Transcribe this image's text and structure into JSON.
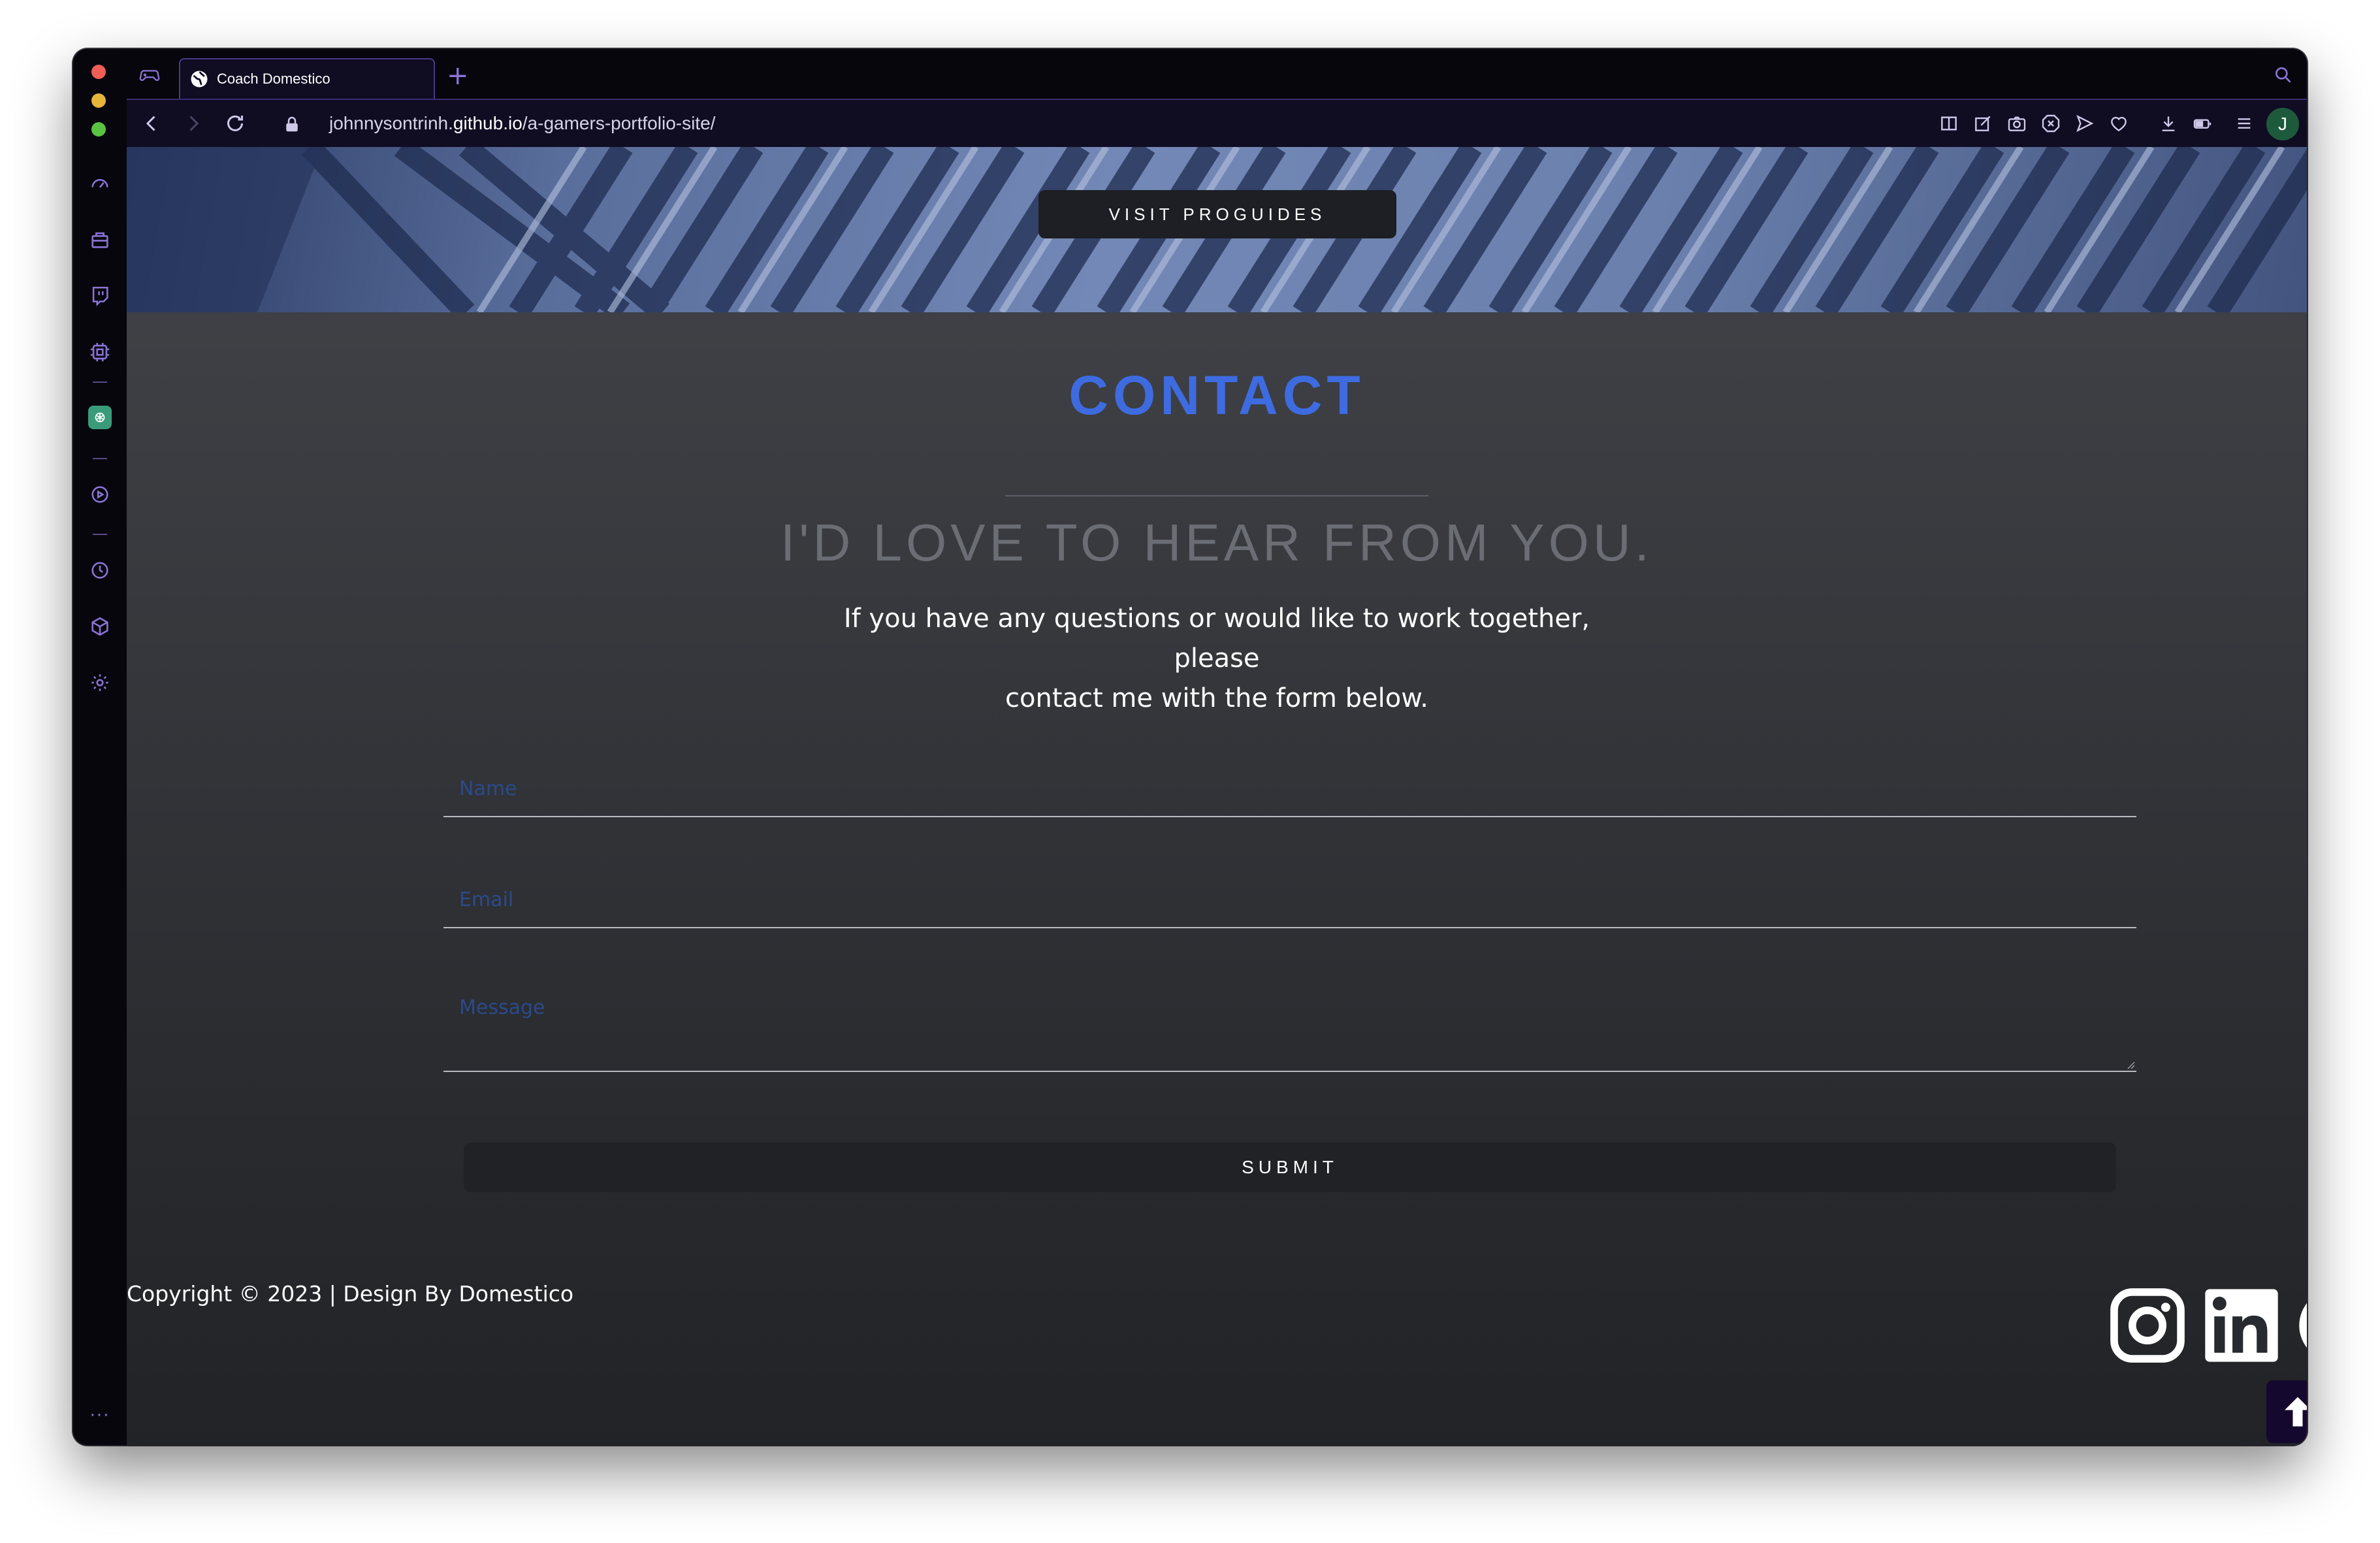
{
  "browser": {
    "tab_title": "Coach Domestico",
    "url_host_prefix": "johnnysontrinh.",
    "url_host_bold": "github.io",
    "url_path": "/a-gamers-portfolio-site/",
    "avatar_letter": "J",
    "new_tab": "+",
    "sidebar_more": "···",
    "accent": "#8b74d6"
  },
  "hero": {
    "button_label": "VISIT PROGUIDES"
  },
  "contact": {
    "title": "CONTACT",
    "subtitle": "I'D LOVE TO HEAR FROM YOU.",
    "intro_line1": "If you have any questions or would like to work together, please",
    "intro_line2": "contact me with the form below.",
    "name_placeholder": "Name",
    "email_placeholder": "Email",
    "message_placeholder": "Message",
    "submit_label": "SUBMIT",
    "title_color": "#3e6be0"
  },
  "footer": {
    "copyright": "Copyright © 2023 | Design By Domestico",
    "social": [
      "instagram-icon",
      "linkedin-icon",
      "github-icon"
    ],
    "back_to_top": "arrow-up-icon"
  }
}
